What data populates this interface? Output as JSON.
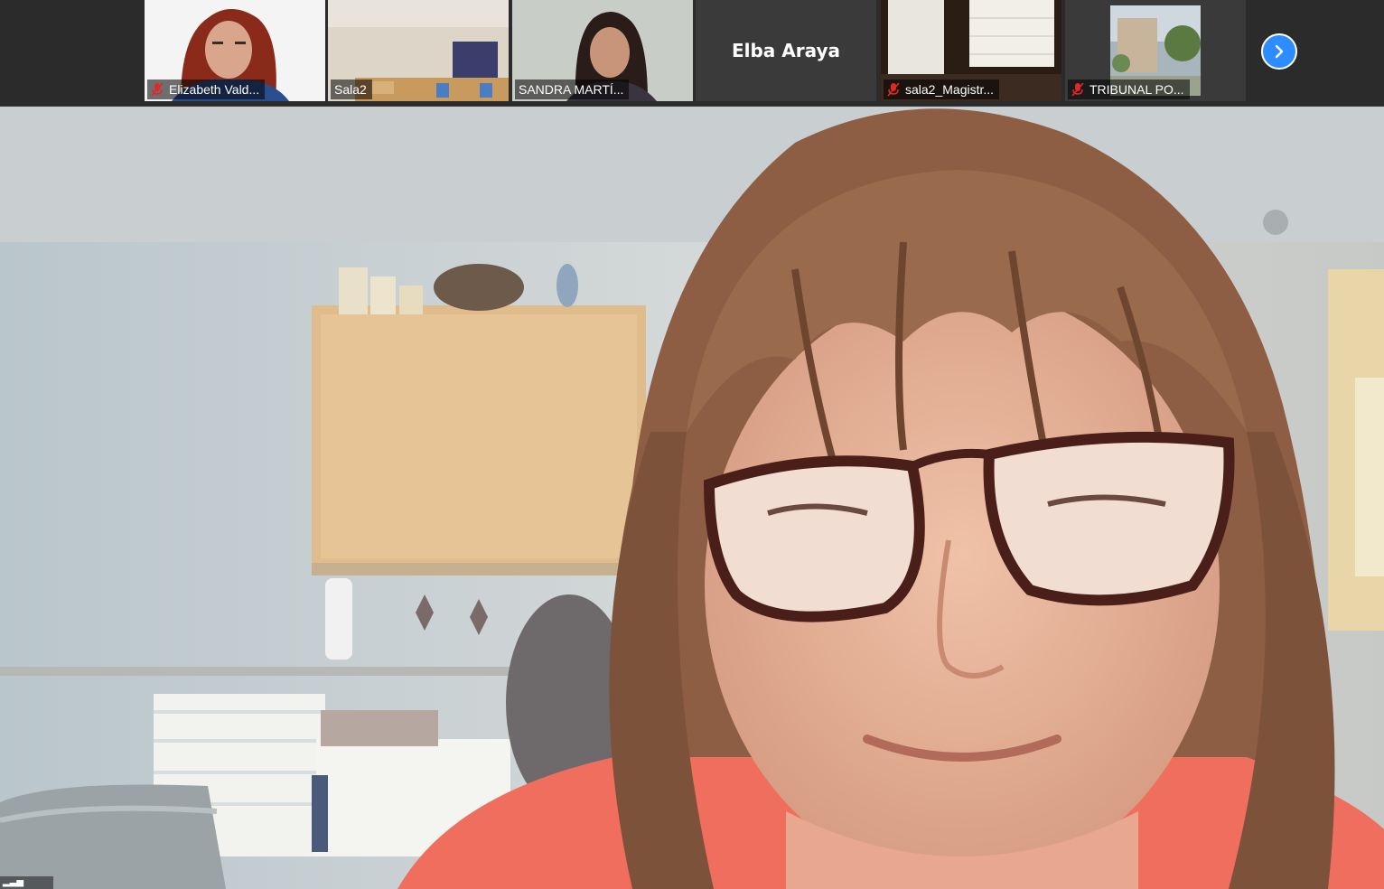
{
  "gallery": {
    "tiles": [
      {
        "label": "Elizabeth Vald...",
        "muted": true
      },
      {
        "label": "Sala2",
        "muted": false
      },
      {
        "label": "SANDRA MARTÍ...",
        "muted": false
      },
      {
        "label": "Elba Araya",
        "muted": false,
        "video_off": true
      },
      {
        "label": "sala2_Magistr...",
        "muted": true
      },
      {
        "label": "TRIBUNAL PO...",
        "muted": true
      }
    ],
    "next_icon": "chevron-right-icon"
  },
  "colors": {
    "accent": "#2d8cff",
    "mute": "#e02828",
    "strip_bg": "#2b2b2b"
  }
}
